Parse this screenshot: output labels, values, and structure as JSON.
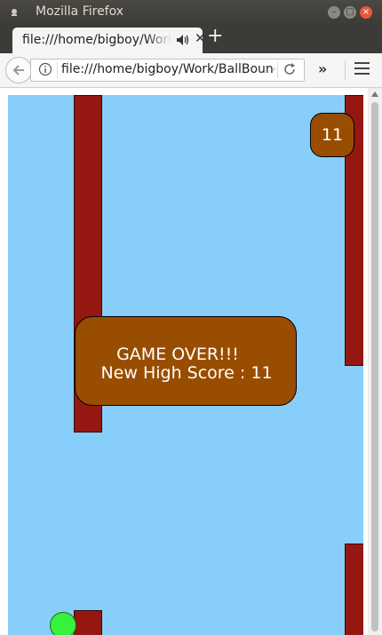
{
  "window": {
    "title": "Mozilla Firefox"
  },
  "tab": {
    "label": "file:///home/bigboy/Work/BallBounce"
  },
  "navbar": {
    "url": "file:///home/bigboy/Work/BallBounce"
  },
  "game": {
    "score": "11",
    "game_over_line1": "GAME OVER!!!",
    "game_over_line2": "New High Score : 11",
    "colors": {
      "sky": "#87cefa",
      "pipe": "#951712",
      "panel": "#994d00",
      "ball": "#36f23c"
    }
  }
}
